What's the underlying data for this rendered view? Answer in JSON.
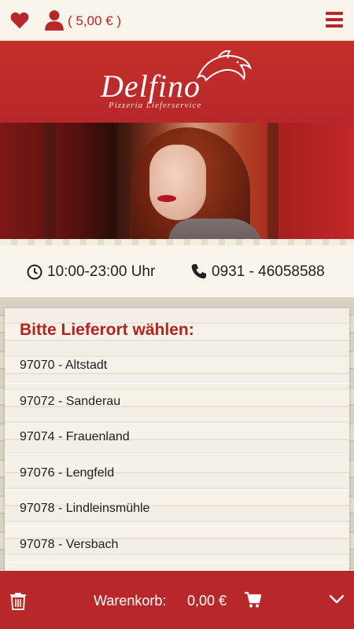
{
  "header": {
    "credit": "( 5,00 € )",
    "icons": {
      "favorites": "heart-icon",
      "account": "user-icon",
      "menu": "hamburger-menu-icon"
    }
  },
  "brand": {
    "name": "Delfino",
    "tagline": "Pizzeria  Lieferservice",
    "logo_icon": "dolphin-icon"
  },
  "info": {
    "hours": "10:00-23:00 Uhr",
    "phone": "0931 - 46058588"
  },
  "delivery": {
    "heading": "Bitte Lieferort wählen:",
    "locations": [
      {
        "label": "97070 - Altstadt"
      },
      {
        "label": "97072 - Sanderau"
      },
      {
        "label": "97074 - Frauenland"
      },
      {
        "label": "97076 - Lengfeld"
      },
      {
        "label": "97078 - Lindleinsmühle"
      },
      {
        "label": "97078 - Versbach"
      }
    ]
  },
  "cart": {
    "label": "Warenkorb:",
    "amount": "0,00 €"
  },
  "colors": {
    "brand_red": "#b8282a",
    "cream": "#faf5ec",
    "heading_red": "#b3231f"
  }
}
